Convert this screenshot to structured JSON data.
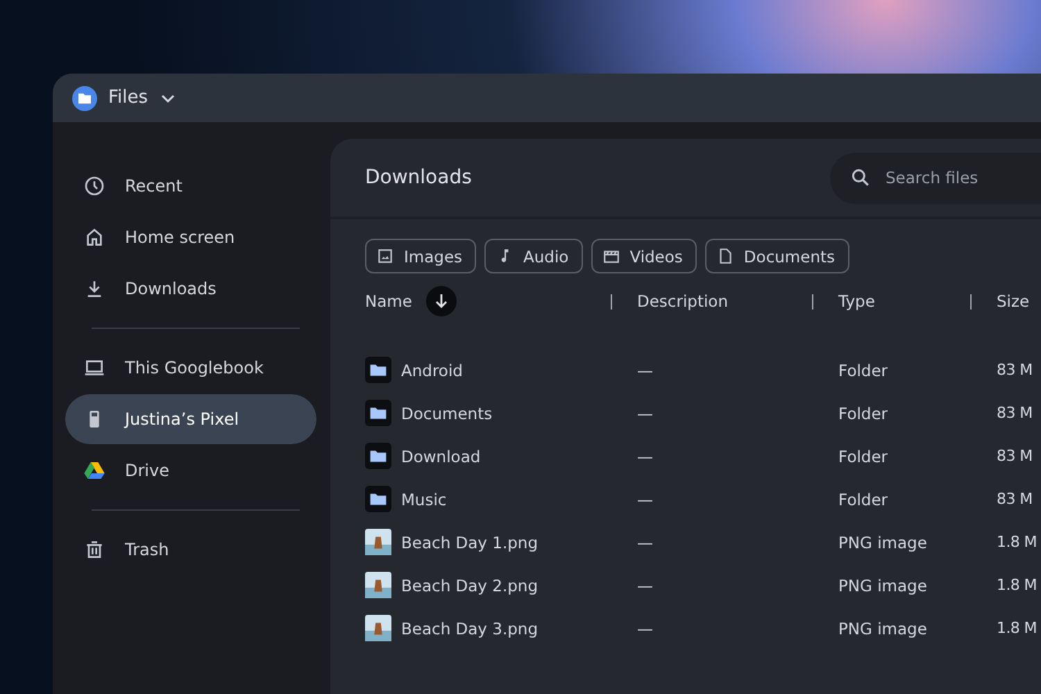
{
  "window": {
    "title": "Files"
  },
  "sidebar": {
    "groups": [
      [
        {
          "label": "Recent",
          "selected": false
        },
        {
          "label": "Home screen",
          "selected": false
        },
        {
          "label": "Downloads",
          "selected": false
        }
      ],
      [
        {
          "label": "This Googlebook",
          "selected": false
        },
        {
          "label": "Justina’s Pixel",
          "selected": true
        },
        {
          "label": "Drive",
          "selected": false
        }
      ],
      [
        {
          "label": "Trash",
          "selected": false
        }
      ]
    ]
  },
  "main": {
    "title": "Downloads",
    "search": {
      "placeholder": "Search files"
    },
    "filters": [
      {
        "label": "Images"
      },
      {
        "label": "Audio"
      },
      {
        "label": "Videos"
      },
      {
        "label": "Documents"
      }
    ],
    "table": {
      "columns": [
        "Name",
        "Description",
        "Type",
        "Size"
      ],
      "rows": [
        {
          "kind": "folder",
          "name": "Android",
          "description": "—",
          "type": "Folder",
          "size": "83 M"
        },
        {
          "kind": "folder",
          "name": "Documents",
          "description": "—",
          "type": "Folder",
          "size": "83 M"
        },
        {
          "kind": "folder",
          "name": "Download",
          "description": "—",
          "type": "Folder",
          "size": "83 M"
        },
        {
          "kind": "folder",
          "name": "Music",
          "description": "—",
          "type": "Folder",
          "size": "83 M"
        },
        {
          "kind": "image",
          "name": "Beach Day 1.png",
          "description": "—",
          "type": "PNG image",
          "size": "1.8 M"
        },
        {
          "kind": "image",
          "name": "Beach Day 2.png",
          "description": "—",
          "type": "PNG image",
          "size": "1.8 M"
        },
        {
          "kind": "image",
          "name": "Beach Day 3.png",
          "description": "—",
          "type": "PNG image",
          "size": "1.8 M"
        }
      ]
    }
  }
}
